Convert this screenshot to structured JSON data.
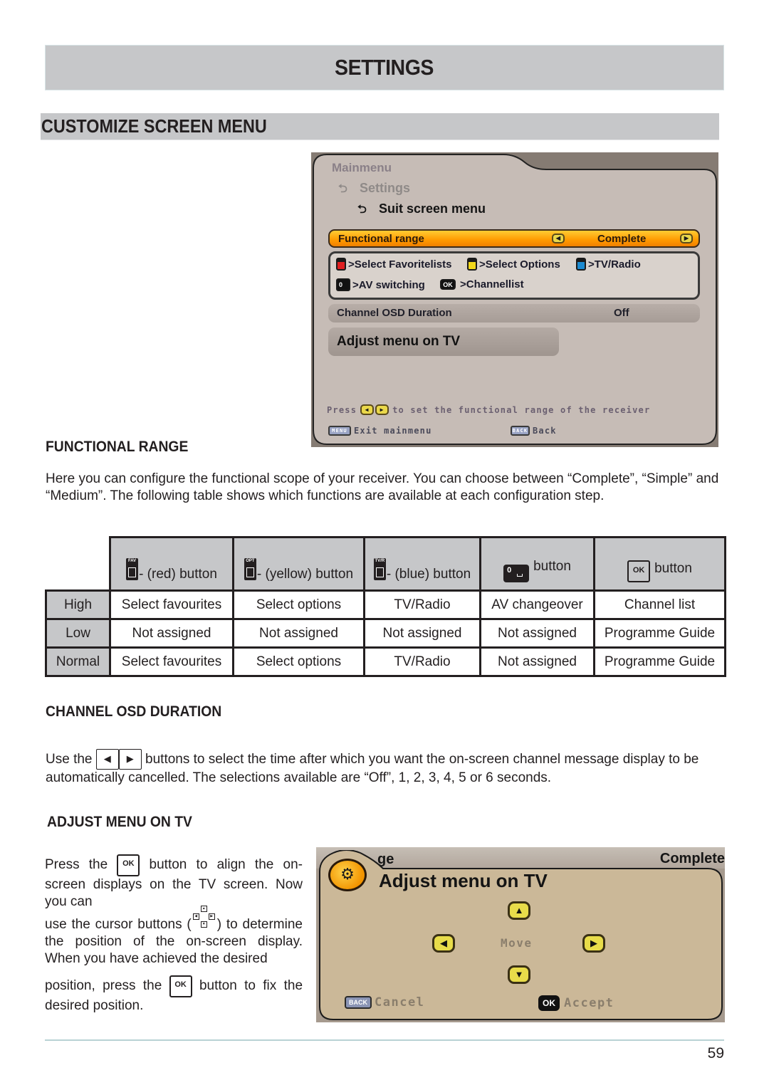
{
  "page": {
    "title": "SETTINGS",
    "section": "CUSTOMIZE SCREEN MENU",
    "page_number": "59"
  },
  "tv_menu": {
    "breadcrumb": [
      "Mainmenu",
      "Settings",
      "Suit screen menu"
    ],
    "functional_range": {
      "label": "Functional range",
      "value": "Complete"
    },
    "hints": [
      {
        "key": "red",
        "label": ">Select Favoritelists"
      },
      {
        "key": "yellow",
        "label": ">Select Options"
      },
      {
        "key": "blue",
        "label": ">TV/Radio"
      },
      {
        "key": "0",
        "label": ">AV switching"
      },
      {
        "key": "OK",
        "label": ">Channellist"
      }
    ],
    "osd_duration": {
      "label": "Channel OSD Duration",
      "value": "Off"
    },
    "adjust_item": "Adjust menu on TV",
    "press_prefix": "Press",
    "press_suffix": "to set the functional range of the receiver",
    "footer": [
      {
        "key": "MENU",
        "label": "Exit mainmenu"
      },
      {
        "key": "BACK",
        "label": "Back"
      }
    ]
  },
  "functional_range": {
    "heading": "FUNCTIONAL RANGE",
    "description": "Here you can configure the functional scope of your receiver. You can choose between “Complete”, “Simple” and “Medium”. The following table shows which functions are available at each configuration step.",
    "table": {
      "columns": [
        {
          "key_tag": "FAV",
          "label": "- (red) button"
        },
        {
          "key_tag": "OPT",
          "label": "- (yellow) button"
        },
        {
          "key_tag": "TV/R",
          "label": "- (blue) button"
        },
        {
          "key_tag": "0",
          "label": "button"
        },
        {
          "key_tag": "OK",
          "label": "button"
        }
      ],
      "rows": [
        {
          "level": "High",
          "cells": [
            "Select favourites",
            "Select options",
            "TV/Radio",
            "AV changeover",
            "Channel list"
          ]
        },
        {
          "level": "Low",
          "cells": [
            "Not assigned",
            "Not assigned",
            "Not assigned",
            "Not assigned",
            "Programme Guide"
          ]
        },
        {
          "level": "Normal",
          "cells": [
            "Select favourites",
            "Select options",
            "TV/Radio",
            "Not assigned",
            "Programme Guide"
          ]
        }
      ]
    }
  },
  "osd_duration": {
    "heading": "CHANNEL OSD DURATION",
    "text_before": "Use the",
    "text_after": "buttons to select the time after which you want the on-screen channel message display to be automatically cancelled. The selections available are “Off”, 1, 2, 3, 4, 5 or 6 seconds."
  },
  "adjust_menu": {
    "heading": "ADJUST MENU ON TV",
    "p1_before": "Press the",
    "p1_after": "button to align the on-screen displays on the TV screen. Now you can",
    "p2_before": "use the cursor buttons (",
    "p2_after": ") to determine the position of the on-screen display. When you have achieved the desired",
    "p3_before": "position, press the",
    "p3_after": "button to fix the desired position.",
    "ok_key": "OK"
  },
  "tv_adjust": {
    "bg_left": "ge",
    "bg_right": "Complete",
    "title": "Adjust menu on TV",
    "move_label": "Move",
    "cancel_key": "BACK",
    "cancel_label": "Cancel",
    "accept_key": "OK",
    "accept_label": "Accept"
  },
  "colors": {
    "header_gray": "#c6c7c9",
    "highlight_orange": "#ff9900",
    "hint_red": "#e02020",
    "hint_yellow": "#f2d81a",
    "hint_blue": "#1c8ad0"
  }
}
